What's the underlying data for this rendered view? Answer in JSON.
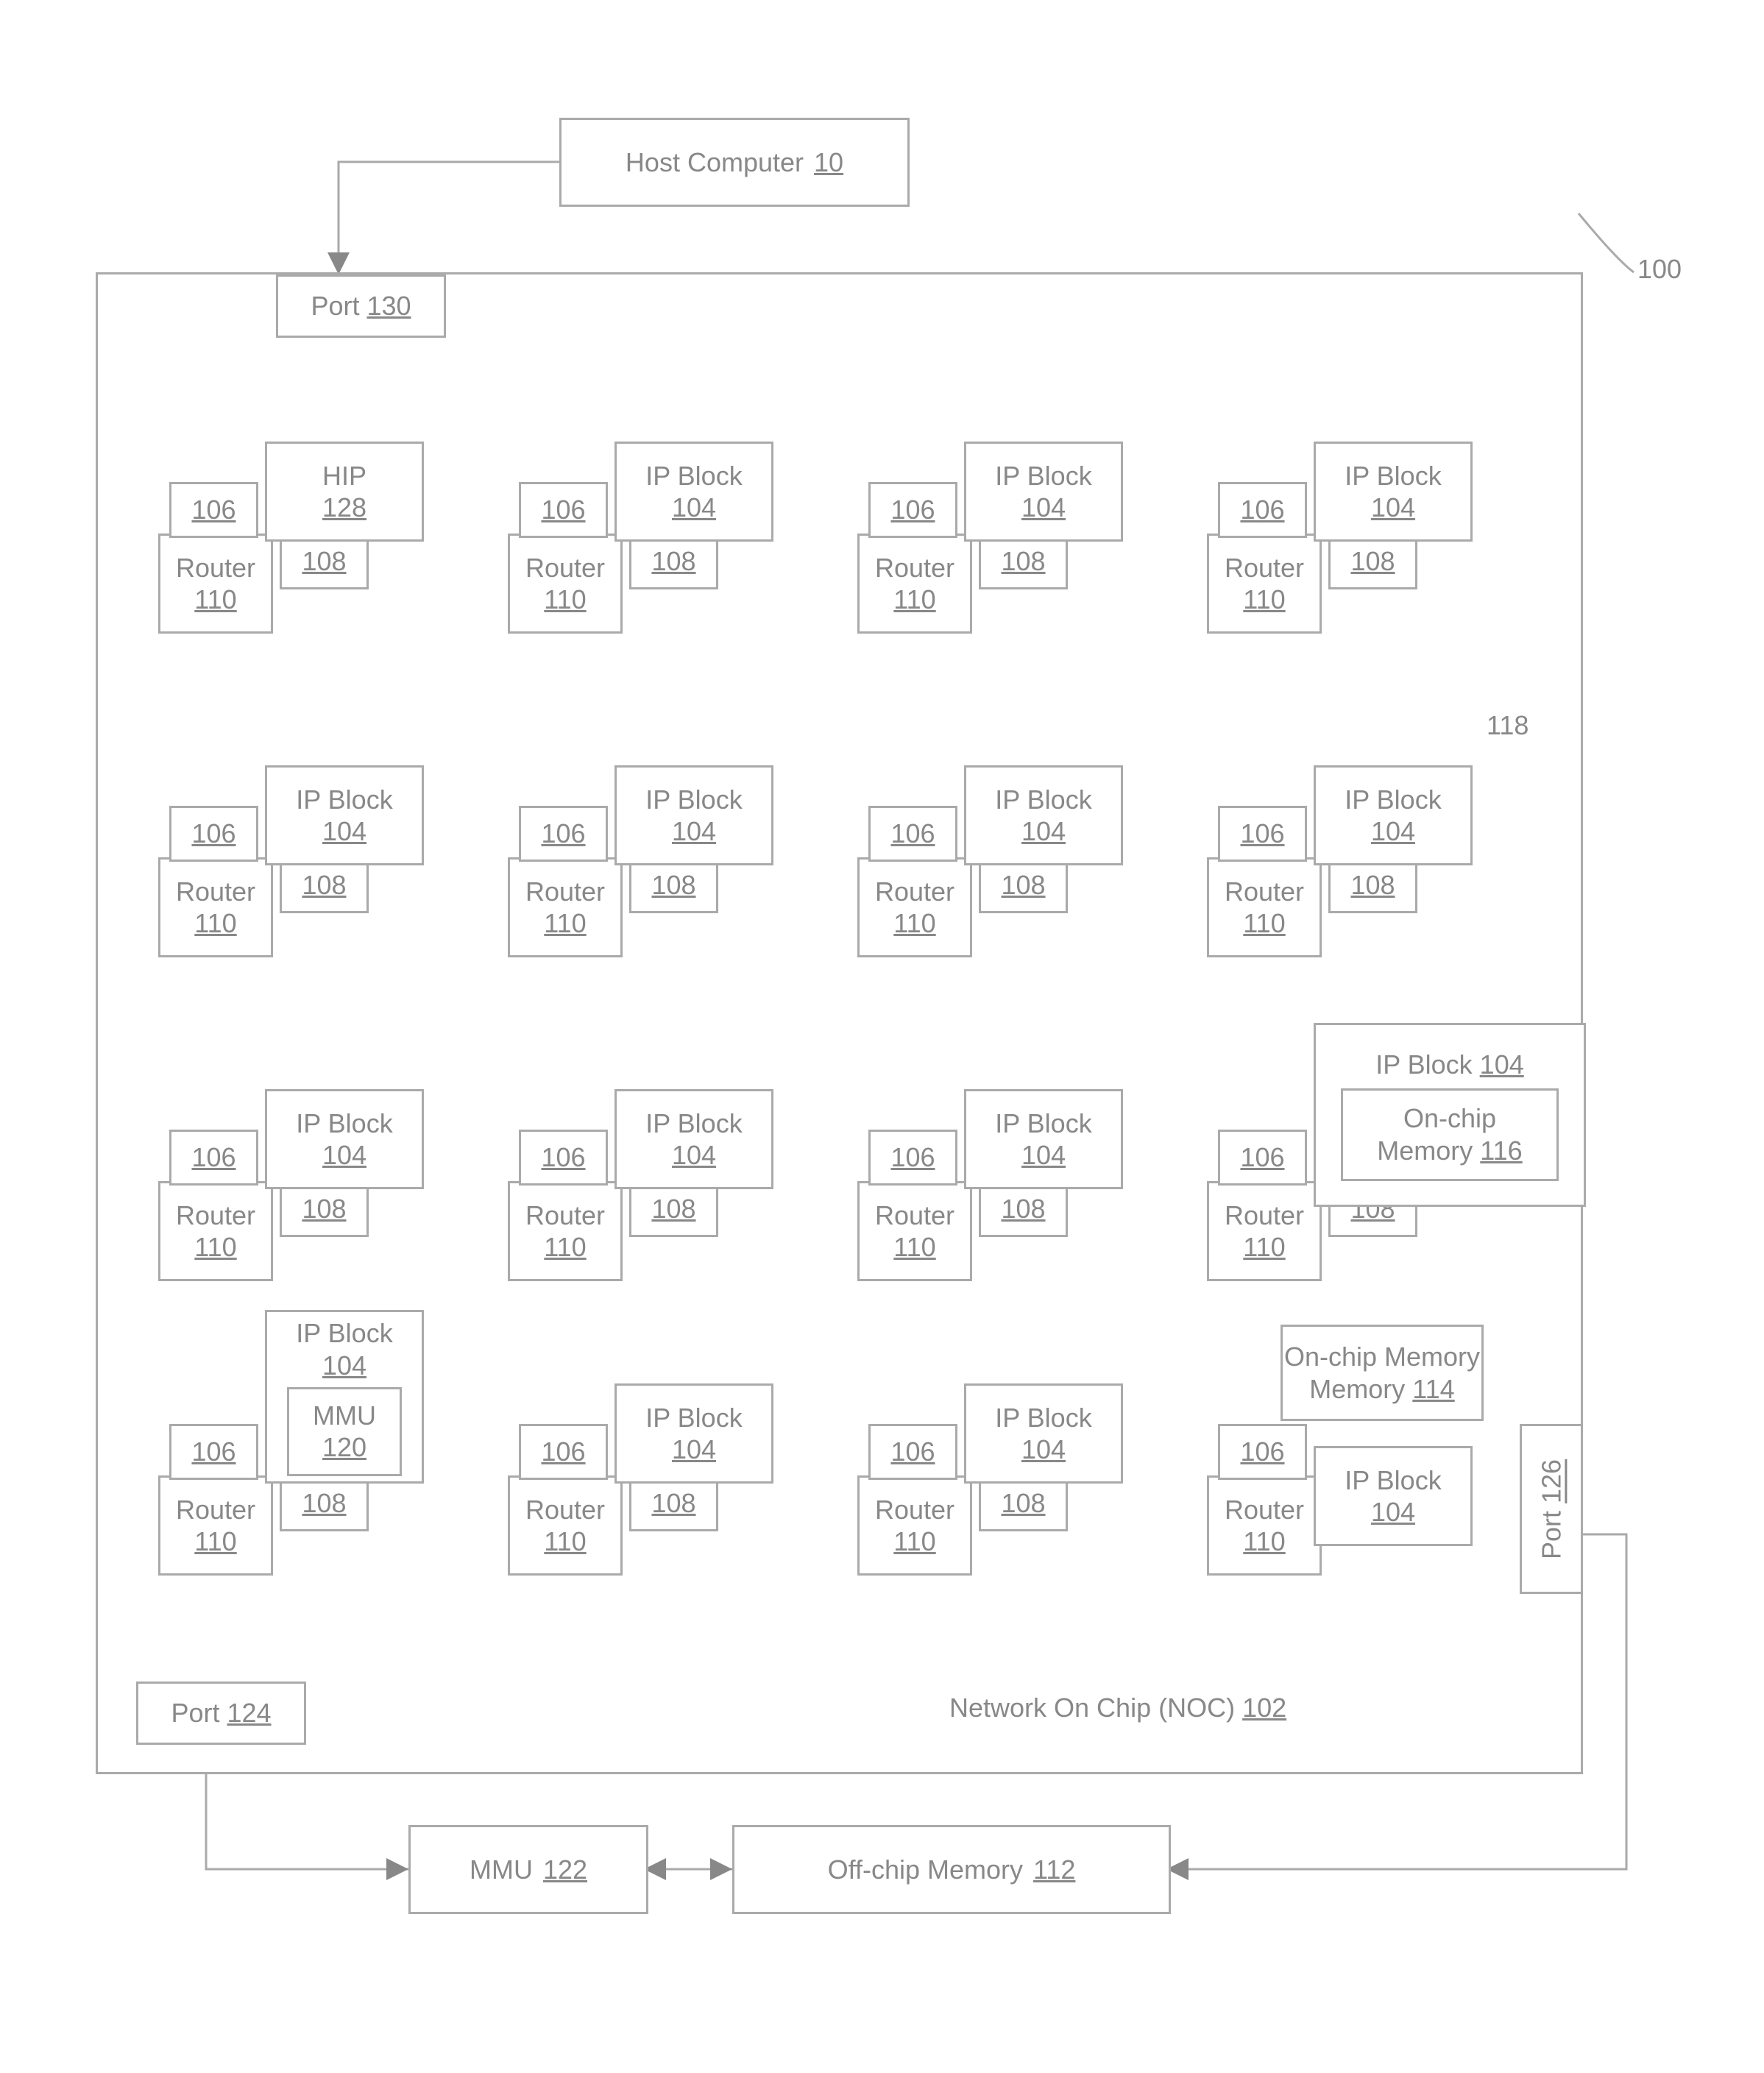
{
  "host": {
    "label": "Host Computer",
    "ref": "10"
  },
  "chip": {
    "ref": "100"
  },
  "port_top": {
    "label": "Port",
    "ref": "130"
  },
  "hip": {
    "label": "HIP",
    "ref": "128"
  },
  "ipblock": {
    "label": "IP Block",
    "ref": "104"
  },
  "router": {
    "label": "Router",
    "ref": "110"
  },
  "b106": "106",
  "b108": "108",
  "wire118": "118",
  "onchip_mem_ip": {
    "label": "On-chip Memory",
    "ref": "116"
  },
  "mmu_in": {
    "label": "MMU",
    "ref": "120"
  },
  "onchip_mem_ext": {
    "label": "On-chip Memory",
    "ref": "114"
  },
  "port_right": {
    "label": "Port",
    "ref": "126"
  },
  "port_bottom": {
    "label": "Port",
    "ref": "124"
  },
  "noc": {
    "label": "Network On Chip (NOC)",
    "ref": "102"
  },
  "mmu_ext": {
    "label": "MMU",
    "ref": "122"
  },
  "offchip": {
    "label": "Off-chip  Memory",
    "ref": "112"
  }
}
